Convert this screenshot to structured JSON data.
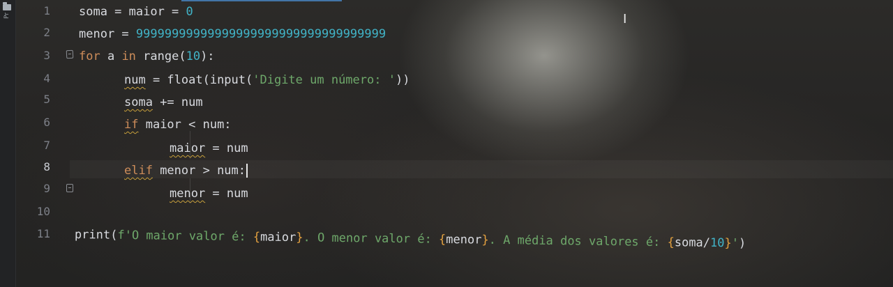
{
  "left_toolbar": {
    "project_tab_label": "Pr"
  },
  "gutter": {
    "line_numbers": [
      "1",
      "2",
      "3",
      "4",
      "5",
      "6",
      "7",
      "8",
      "9",
      "10",
      "11"
    ],
    "current_line": "8"
  },
  "editor": {
    "language": "python",
    "lines": [
      {
        "tokens": [
          {
            "t": "soma = maior = ",
            "c": "plain"
          },
          {
            "t": "0",
            "c": "num"
          }
        ]
      },
      {
        "tokens": [
          {
            "t": "menor = ",
            "c": "plain"
          },
          {
            "t": "99999999999999999999999999999999999",
            "c": "num"
          }
        ]
      },
      {
        "tokens": [
          {
            "t": "for",
            "c": "kw"
          },
          {
            "t": " a ",
            "c": "plain"
          },
          {
            "t": "in",
            "c": "kw"
          },
          {
            "t": " range(",
            "c": "plain"
          },
          {
            "t": "10",
            "c": "num"
          },
          {
            "t": "):",
            "c": "plain"
          }
        ]
      },
      {
        "tokens": [
          {
            "t": "num",
            "c": "plain warn"
          },
          {
            "t": " = float(input(",
            "c": "plain"
          },
          {
            "t": "'Digite um número: '",
            "c": "str"
          },
          {
            "t": "))",
            "c": "plain"
          }
        ]
      },
      {
        "tokens": [
          {
            "t": "soma",
            "c": "plain warn"
          },
          {
            "t": " += num",
            "c": "plain"
          }
        ]
      },
      {
        "tokens": [
          {
            "t": "if",
            "c": "kw warn"
          },
          {
            "t": " maior < num:",
            "c": "plain"
          }
        ]
      },
      {
        "tokens": [
          {
            "t": "maior",
            "c": "plain warn"
          },
          {
            "t": " = num",
            "c": "plain"
          }
        ]
      },
      {
        "tokens": [
          {
            "t": "elif",
            "c": "kw warn"
          },
          {
            "t": " menor > num:",
            "c": "plain"
          }
        ]
      },
      {
        "tokens": [
          {
            "t": "menor",
            "c": "plain warn"
          },
          {
            "t": " = num",
            "c": "plain"
          }
        ]
      },
      {
        "tokens": []
      },
      {
        "tokens": [
          {
            "t": "print(",
            "c": "plain"
          },
          {
            "t": "f'O maior valor é: ",
            "c": "str"
          },
          {
            "t": "{",
            "c": "brace"
          },
          {
            "t": "maior",
            "c": "plain"
          },
          {
            "t": "}",
            "c": "brace"
          },
          {
            "t": ". O menor valor é: ",
            "c": "str"
          },
          {
            "t": "{",
            "c": "brace"
          },
          {
            "t": "menor",
            "c": "plain"
          },
          {
            "t": "}",
            "c": "brace"
          },
          {
            "t": ". A média dos valores é: ",
            "c": "str"
          },
          {
            "t": "{",
            "c": "brace"
          },
          {
            "t": "soma/",
            "c": "plain"
          },
          {
            "t": "10",
            "c": "num"
          },
          {
            "t": "}",
            "c": "brace"
          },
          {
            "t": "'",
            "c": "str"
          },
          {
            "t": ")",
            "c": "plain"
          }
        ]
      }
    ]
  },
  "colors": {
    "keyword": "#ce8d5a",
    "number": "#41b3c7",
    "string": "#6ea86a",
    "identifier": "#d9dbe0",
    "fstring_brace": "#e3a03f",
    "warning_underline": "#c9a13b",
    "line_number": "#7d8088"
  },
  "icons": {
    "project": "folder-icon",
    "fold": "fold-marker-icon",
    "mouse_cursor": "ibeam-cursor-icon"
  },
  "mouse_cursor_glyph": "I"
}
